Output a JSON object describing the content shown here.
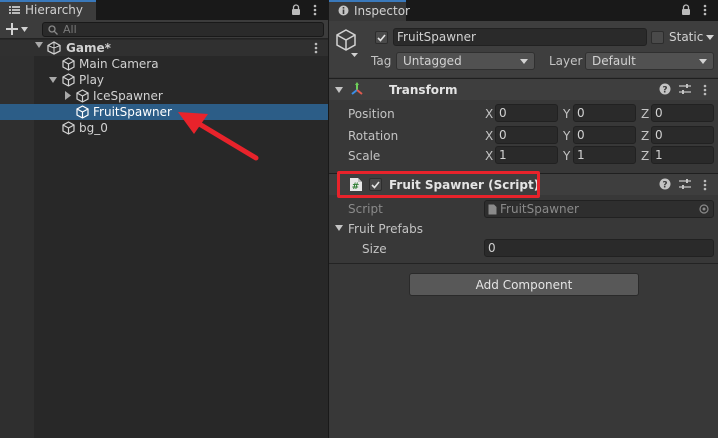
{
  "hierarchy": {
    "tab_label": "Hierarchy",
    "search_placeholder": "All",
    "scene_name": "Game*",
    "items": [
      {
        "label": "Main Camera"
      },
      {
        "label": "Play"
      },
      {
        "label": "IceSpawner"
      },
      {
        "label": "FruitSpawner"
      },
      {
        "label": "bg_0"
      }
    ]
  },
  "inspector": {
    "tab_label": "Inspector",
    "object_name": "FruitSpawner",
    "static_label": "Static",
    "tag_label": "Tag",
    "tag_value": "Untagged",
    "layer_label": "Layer",
    "layer_value": "Default",
    "transform": {
      "title": "Transform",
      "rows": [
        {
          "label": "Position",
          "x": "0",
          "y": "0",
          "z": "0"
        },
        {
          "label": "Rotation",
          "x": "0",
          "y": "0",
          "z": "0"
        },
        {
          "label": "Scale",
          "x": "1",
          "y": "1",
          "z": "1"
        }
      ],
      "axis_labels": {
        "x": "X",
        "y": "Y",
        "z": "Z"
      }
    },
    "script_component": {
      "title": "Fruit Spawner (Script)",
      "script_label": "Script",
      "script_value": "FruitSpawner",
      "prefabs_label": "Fruit Prefabs",
      "size_label": "Size",
      "size_value": "0"
    },
    "add_component_label": "Add Component"
  },
  "colors": {
    "selection": "#2c5d87",
    "annotation_red": "#e8232b",
    "tab_accent": "#3a79bb"
  },
  "icons": [
    "list-icon",
    "lock-icon",
    "kebab-menu-icon",
    "add-icon",
    "search-icon",
    "unity-scene-icon",
    "cube-icon",
    "info-icon",
    "gameobject-icon",
    "transform-icon",
    "script-hash-icon",
    "help-icon",
    "sliders-icon",
    "object-picker-icon"
  ]
}
